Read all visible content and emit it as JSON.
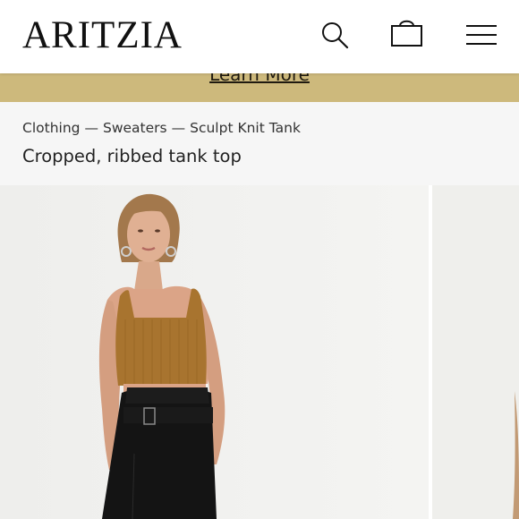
{
  "header": {
    "logo": "ARITZIA",
    "icons": [
      "search-icon",
      "shopping-bag-icon",
      "hamburger-menu-icon"
    ]
  },
  "promo": {
    "link_label": "Learn More",
    "background": "#cdb97c"
  },
  "breadcrumb": {
    "items": [
      "Clothing",
      "Sweaters",
      "Sculpt Knit Tank"
    ],
    "separator": "—"
  },
  "product": {
    "description": "Cropped, ribbed tank top"
  },
  "colors": {
    "info_background": "#f6f6f6",
    "tank_color": "#a8742f",
    "pants_color": "#141414"
  }
}
